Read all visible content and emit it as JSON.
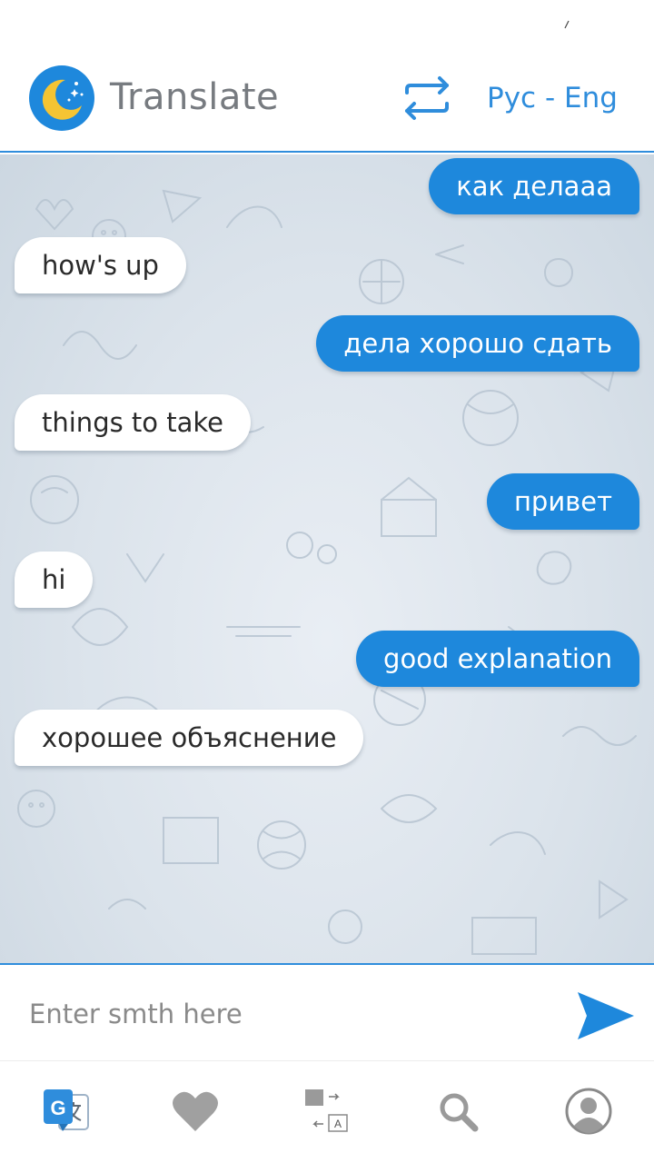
{
  "app": {
    "title": "Translate",
    "language_pair": "Рус - Eng",
    "logo_icon": "moon-stars-icon",
    "swap_icon": "swap-arrows-icon"
  },
  "colors": {
    "accent": "#2f8ddc",
    "outgoing_bubble": "#1e88dc",
    "incoming_bubble": "#ffffff",
    "title_gray": "#777b80",
    "nav_gray": "#a0a0a0"
  },
  "messages": [
    {
      "direction": "out",
      "text": "как делааа"
    },
    {
      "direction": "in",
      "text": "how's up"
    },
    {
      "direction": "out",
      "text": "дела хорошо сдать"
    },
    {
      "direction": "in",
      "text": "things to take"
    },
    {
      "direction": "out",
      "text": "привет"
    },
    {
      "direction": "in",
      "text": "hi"
    },
    {
      "direction": "out",
      "text": "good explanation"
    },
    {
      "direction": "in",
      "text": "хорошее объяснение"
    }
  ],
  "composer": {
    "placeholder": "Enter smth here",
    "send_icon": "send-icon"
  },
  "bottom_nav": [
    {
      "name": "translate",
      "icon": "google-translate-icon",
      "active": true
    },
    {
      "name": "favorites",
      "icon": "heart-icon",
      "active": false
    },
    {
      "name": "cards",
      "icon": "flashcards-icon",
      "active": false
    },
    {
      "name": "search",
      "icon": "search-icon",
      "active": false
    },
    {
      "name": "profile",
      "icon": "user-profile-icon",
      "active": false
    }
  ]
}
